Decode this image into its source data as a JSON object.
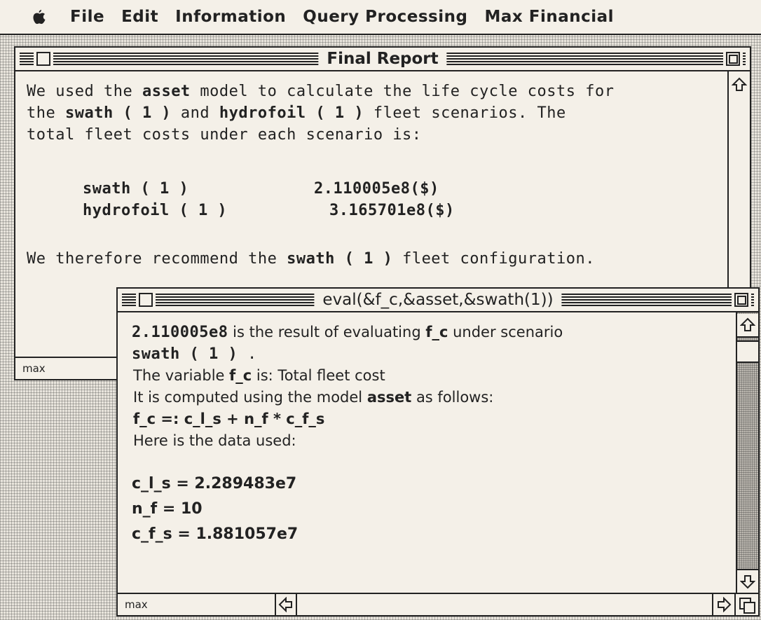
{
  "menubar": {
    "apple_icon": "apple-icon",
    "items": [
      "File",
      "Edit",
      "Information",
      "Query Processing",
      "Max Financial"
    ]
  },
  "final_report": {
    "title": "Final Report",
    "status": "max",
    "intro": {
      "l1_a": "We used the ",
      "l1_model": "asset",
      "l1_b": " model to calculate the life cycle costs for",
      "l2_a": "the ",
      "l2_s1": "swath ( 1 )",
      "l2_b": " and ",
      "l2_s2": "hydrofoil ( 1 )",
      "l2_c": " fleet scenarios.  The",
      "l3": "total fleet costs under each scenario is:"
    },
    "rows": [
      {
        "scenario": "swath ( 1 )",
        "cost": "2.110005e8($)"
      },
      {
        "scenario": "hydrofoil ( 1 )",
        "cost": "3.165701e8($)"
      }
    ],
    "recommend": {
      "a": "We therefore recommend the ",
      "scenario": "swath ( 1 )",
      "b": " fleet configuration."
    }
  },
  "eval_window": {
    "title": "eval(&f_c,&asset,&swath(1))",
    "status": "max",
    "result_value": "2.110005e8",
    "result_text_a": "  is the result of evaluating ",
    "result_var": "f_c",
    "result_text_b": " under scenario",
    "scenario": "swath ( 1 )",
    "scenario_end": " .",
    "var_line_a": "The variable ",
    "var_name": "f_c",
    "var_line_b": " is: Total fleet cost",
    "computed_a": "It is computed using the model ",
    "computed_model": "asset",
    "computed_b": " as follows:",
    "formula": "f_c =: c_l_s + n_f * c_f_s",
    "data_intro": "Here is the data used:",
    "data": [
      "c_l_s = 2.289483e7",
      "n_f = 10",
      "c_f_s = 1.881057e7"
    ]
  }
}
